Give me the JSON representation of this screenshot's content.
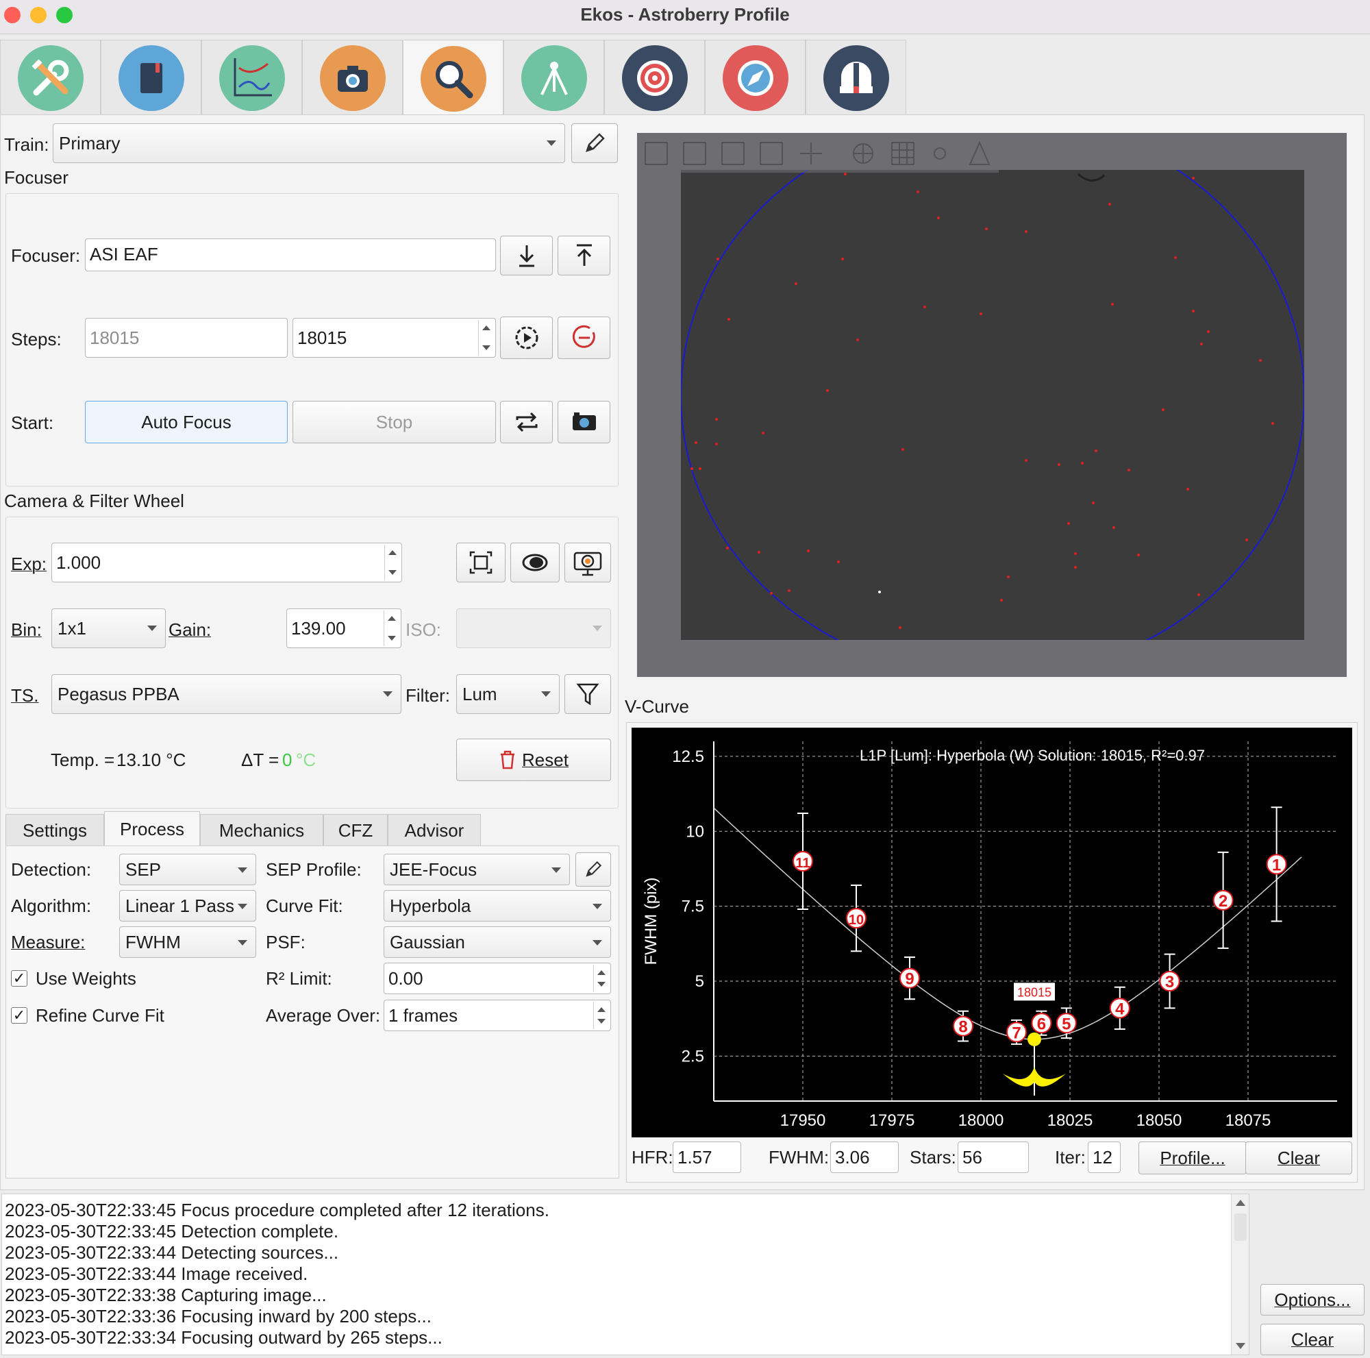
{
  "window": {
    "title": "Ekos - Astroberry Profile"
  },
  "toolbar": {
    "icons": [
      "setup-icon",
      "scheduler-icon",
      "analyze-icon",
      "capture-icon",
      "focus-icon",
      "mount-icon",
      "align-icon",
      "guide-icon",
      "observatory-icon"
    ]
  },
  "train": {
    "label": "Train:",
    "value": "Primary"
  },
  "focuser_group": {
    "title": "Focuser",
    "focuser_label": "Focuser:",
    "focuser_value": "ASI EAF",
    "steps_label": "Steps:",
    "steps_current": "18015",
    "steps_target": "18015",
    "start_label": "Start:",
    "auto_focus": "Auto Focus",
    "stop": "Stop"
  },
  "camera_group": {
    "title": "Camera & Filter Wheel",
    "exp_label": "Exp:",
    "exp_value": "1.000",
    "bin_label": "Bin:",
    "bin_value": "1x1",
    "gain_label": "Gain:",
    "gain_value": "139.00",
    "iso_label": "ISO:",
    "ts_label": "TS.",
    "ts_value": "Pegasus PPBA",
    "filter_label": "Filter:",
    "filter_value": "Lum",
    "temp_label": "Temp. =",
    "temp_value": "13.10 °C",
    "delta_label": "ΔT =",
    "delta_value": "0",
    "delta_unit": "°C",
    "reset": "Reset"
  },
  "tabs": [
    "Settings",
    "Process",
    "Mechanics",
    "CFZ",
    "Advisor"
  ],
  "process": {
    "detection_label": "Detection:",
    "detection_value": "SEP",
    "sep_profile_label": "SEP Profile:",
    "sep_profile_value": "JEE-Focus",
    "algorithm_label": "Algorithm:",
    "algorithm_value": "Linear 1 Pass",
    "curve_fit_label": "Curve Fit:",
    "curve_fit_value": "Hyperbola",
    "measure_label": "Measure:",
    "measure_value": "FWHM",
    "psf_label": "PSF:",
    "psf_value": "Gaussian",
    "use_weights": "Use Weights",
    "r2_label": "R² Limit:",
    "r2_value": "0.00",
    "refine_curve_fit": "Refine Curve Fit",
    "average_label": "Average Over:",
    "average_value": "1 frames"
  },
  "vcurve": {
    "title": "V-Curve",
    "hfr_label": "HFR:",
    "hfr_value": "1.57",
    "fwhm_label": "FWHM:",
    "fwhm_value": "3.06",
    "stars_label": "Stars:",
    "stars_value": "56",
    "iter_label": "Iter:",
    "iter_value": "12",
    "profile_btn": "Profile...",
    "clear_btn": "Clear"
  },
  "chart_data": {
    "type": "scatter",
    "title": "L1P [Lum]: Hyperbola (W) Solution: 18015, R²=0.97",
    "ylabel": "FWHM (pix)",
    "xlabel": "",
    "xlim": [
      17925,
      18100
    ],
    "ylim": [
      1.0,
      13.0
    ],
    "x_ticks": [
      "17950",
      "17975",
      "18000",
      "18025",
      "18050",
      "18075"
    ],
    "y_ticks": [
      "12.5",
      "10",
      "7.5",
      "5",
      "2.5"
    ],
    "points": [
      {
        "label": "1",
        "x": 18083,
        "y": 8.9,
        "err": 1.9
      },
      {
        "label": "2",
        "x": 18068,
        "y": 7.7,
        "err": 1.6
      },
      {
        "label": "3",
        "x": 18053,
        "y": 5.0,
        "err": 0.9
      },
      {
        "label": "4",
        "x": 18039,
        "y": 4.1,
        "err": 0.7
      },
      {
        "label": "5",
        "x": 18024,
        "y": 3.6,
        "err": 0.5
      },
      {
        "label": "6",
        "x": 18017,
        "y": 3.6,
        "err": 0.4
      },
      {
        "label": "7",
        "x": 18010,
        "y": 3.3,
        "err": 0.4
      },
      {
        "label": "8",
        "x": 17995,
        "y": 3.5,
        "err": 0.5
      },
      {
        "label": "9",
        "x": 17980,
        "y": 5.1,
        "err": 0.7
      },
      {
        "label": "10",
        "x": 17965,
        "y": 7.1,
        "err": 1.1
      },
      {
        "label": "11",
        "x": 17950,
        "y": 9.0,
        "err": 1.6
      }
    ],
    "solution": {
      "x": 18015,
      "y": 3.06,
      "label": "18015"
    },
    "grid": true
  },
  "log": {
    "lines": [
      "2023-05-30T22:33:45 Focus procedure completed after 12 iterations.",
      "2023-05-30T22:33:45 Detection complete.",
      "2023-05-30T22:33:44 Detecting sources...",
      "2023-05-30T22:33:44 Image received.",
      "2023-05-30T22:33:38 Capturing image...",
      "2023-05-30T22:33:36 Focusing inward by 200 steps...",
      "2023-05-30T22:33:34 Focusing outward by 265 steps..."
    ],
    "options_btn": "Options...",
    "clear_btn": "Clear"
  },
  "colors": {
    "accent": "#6aa7e8",
    "delta_green": "#3cc83c",
    "marker_red": "#e0191b",
    "solution_yellow": "#ffef00"
  }
}
